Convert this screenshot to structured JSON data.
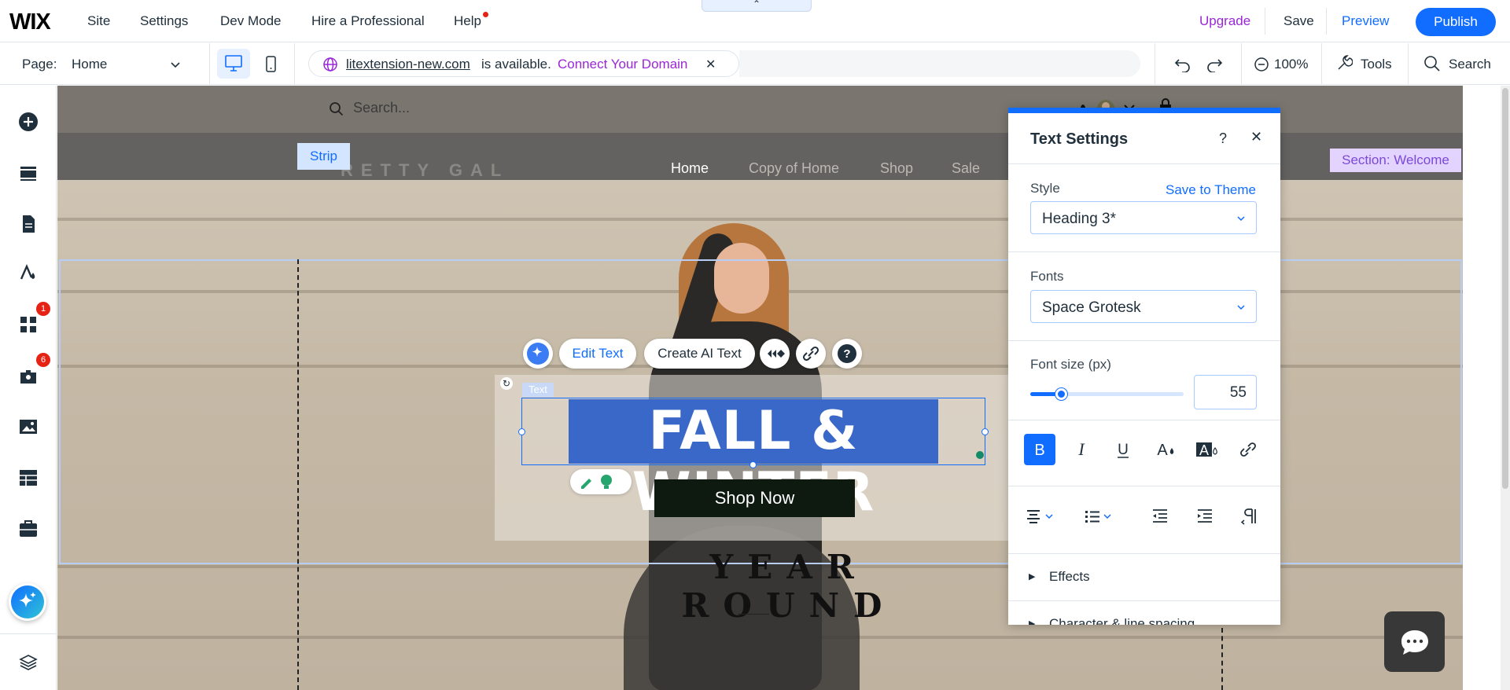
{
  "topbar": {
    "logo": "WIX",
    "menu": [
      "Site",
      "Settings",
      "Dev Mode",
      "Hire a Professional",
      "Help"
    ],
    "upgrade": "Upgrade",
    "save": "Save",
    "preview": "Preview",
    "publish": "Publish"
  },
  "toolbar2": {
    "page_label": "Page:",
    "page_value": "Home",
    "domain_name": "litextension-new.com",
    "domain_available": "is available.",
    "domain_connect": "Connect Your Domain",
    "zoom": "100%",
    "tools": "Tools",
    "search": "Search"
  },
  "leftbar": {
    "badges": [
      "1",
      "6"
    ]
  },
  "canvas": {
    "site_search_placeholder": "Search...",
    "brand": "RETTY GAL",
    "nav": [
      "Home",
      "Copy of Home",
      "Shop",
      "Sale"
    ],
    "strip_tag": "Strip",
    "section_tag": "Section: Welcome",
    "text_tag": "Text",
    "heading": "FALL & WINTER",
    "shop_now": "Shop Now",
    "tagline": "YEAR ROUND"
  },
  "floating_toolbar": {
    "edit_text": "Edit Text",
    "create_ai_text": "Create AI Text"
  },
  "text_settings": {
    "title": "Text Settings",
    "style_label": "Style",
    "save_to_theme": "Save to Theme",
    "style_value": "Heading 3*",
    "fonts_label": "Fonts",
    "font_value": "Space Grotesk",
    "font_size_label": "Font size (px)",
    "font_size_value": "55",
    "font_size_slider": 0.2,
    "effects": "Effects",
    "char_spacing": "Character & line spacing"
  },
  "colors": {
    "accent": "#116dff",
    "upgrade": "#9a27d5",
    "badge": "#e62214"
  }
}
